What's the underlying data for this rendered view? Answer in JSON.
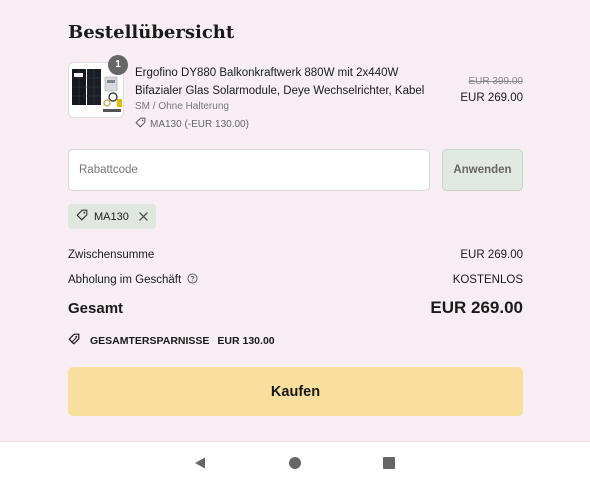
{
  "title": "Bestellübersicht",
  "product": {
    "quantity": "1",
    "name": "Ergofino DY880 Balkonkraftwerk 880W mit 2x440W Bifazialer Glas Solarmodule, Deye Wechselrichter, Kabel",
    "variant": "SM / Ohne Halterung",
    "discount_note": "MA130 (-EUR 130.00)",
    "original_price": "EUR 399.00",
    "price": "EUR 269.00",
    "thumbnail_icon": "solar-panel-image"
  },
  "discount": {
    "placeholder": "Rabattcode",
    "value": "",
    "apply_label": "Anwenden",
    "applied_code": "MA130"
  },
  "summary": {
    "subtotal_label": "Zwischensumme",
    "subtotal_value": "EUR 269.00",
    "pickup_label": "Abholung im Geschäft",
    "pickup_value": "KOSTENLOS",
    "total_label": "Gesamt",
    "total_value": "EUR 269.00",
    "savings_label": "GESAMTERSPARNISSE",
    "savings_value": "EUR 130.00"
  },
  "buy_label": "Kaufen",
  "colors": {
    "background": "#f6eef3",
    "buy_button": "#f8df9e",
    "chip": "#e0e6e0",
    "apply_button": "#e2e8e2"
  },
  "navbar": {
    "icons": [
      "back-icon",
      "home-icon",
      "recents-icon"
    ]
  }
}
